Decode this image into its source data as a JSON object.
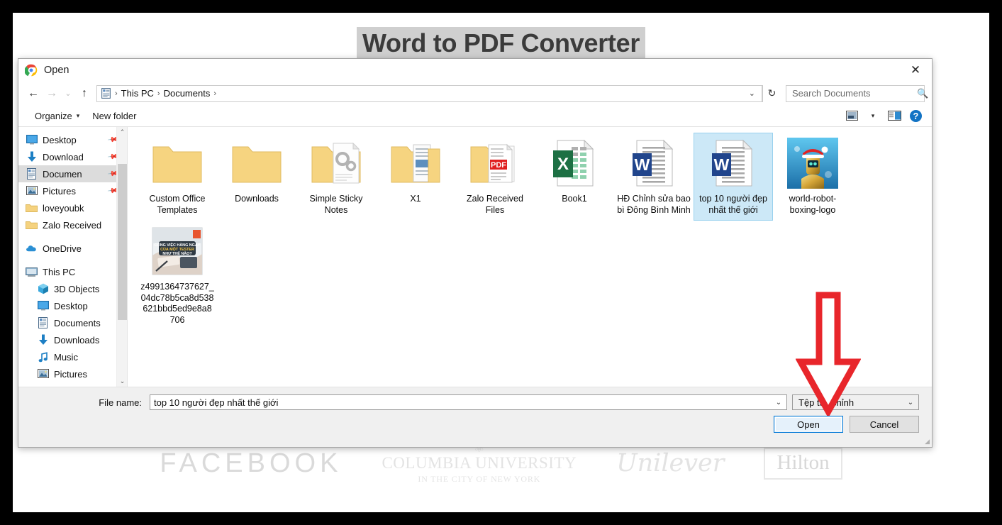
{
  "background_page": {
    "title": "Word to PDF Converter",
    "logos": [
      {
        "name": "FACEBOOK",
        "kind": "wordmark"
      },
      {
        "name": "COLUMBIA UNIVERSITY",
        "subtitle": "IN THE CITY OF NEW YORK",
        "kind": "crest"
      },
      {
        "name": "Unilever",
        "kind": "script"
      },
      {
        "name": "Hilton",
        "kind": "boxed"
      }
    ]
  },
  "dialog": {
    "title": "Open",
    "app_icon": "chrome-icon",
    "close_label": "✕",
    "navigation": {
      "back": "←",
      "forward": "→",
      "recent": "⌄",
      "up": "↑"
    },
    "breadcrumb": {
      "icon": "documents-icon",
      "segments": [
        "This PC",
        "Documents"
      ],
      "separator": "›",
      "trailing_separator": "›",
      "dropdown": "⌄",
      "refresh": "↻"
    },
    "search": {
      "placeholder": "Search Documents",
      "value": "",
      "icon": "search-icon"
    },
    "command_bar": {
      "organize": "Organize",
      "organize_caret": "▾",
      "new_folder": "New folder",
      "view_icon": "view-options-icon",
      "view_caret": "▾",
      "pane_icon": "preview-pane-icon",
      "help_icon": "help-icon",
      "help_glyph": "?"
    },
    "nav_pane": {
      "items": [
        {
          "label": "Desktop",
          "icon": "desktop-icon",
          "pinned": true,
          "indent": 0,
          "selected": false
        },
        {
          "label": "Download",
          "icon": "download-icon",
          "pinned": true,
          "indent": 0,
          "selected": false
        },
        {
          "label": "Documen",
          "icon": "documents-icon",
          "pinned": true,
          "indent": 0,
          "selected": true
        },
        {
          "label": "Pictures",
          "icon": "pictures-icon",
          "pinned": true,
          "indent": 0,
          "selected": false
        },
        {
          "label": "loveyoubk",
          "icon": "folder-icon",
          "pinned": false,
          "indent": 0,
          "selected": false
        },
        {
          "label": "Zalo Received",
          "icon": "folder-icon",
          "pinned": false,
          "indent": 0,
          "selected": false
        },
        {
          "label": "__GAP__",
          "icon": "",
          "pinned": false,
          "indent": 0,
          "selected": false
        },
        {
          "label": "OneDrive",
          "icon": "onedrive-icon",
          "pinned": false,
          "indent": 0,
          "selected": false
        },
        {
          "label": "__GAP__",
          "icon": "",
          "pinned": false,
          "indent": 0,
          "selected": false
        },
        {
          "label": "This PC",
          "icon": "thispc-icon",
          "pinned": false,
          "indent": 0,
          "selected": false
        },
        {
          "label": "3D Objects",
          "icon": "3dobjects-icon",
          "pinned": false,
          "indent": 1,
          "selected": false
        },
        {
          "label": "Desktop",
          "icon": "desktop-icon",
          "pinned": false,
          "indent": 1,
          "selected": false
        },
        {
          "label": "Documents",
          "icon": "documents-icon",
          "pinned": false,
          "indent": 1,
          "selected": false
        },
        {
          "label": "Downloads",
          "icon": "download-icon",
          "pinned": false,
          "indent": 1,
          "selected": false
        },
        {
          "label": "Music",
          "icon": "music-icon",
          "pinned": false,
          "indent": 1,
          "selected": false
        },
        {
          "label": "Pictures",
          "icon": "pictures-icon",
          "pinned": false,
          "indent": 1,
          "selected": false
        }
      ],
      "scrollbar": {
        "up": "⌃",
        "down": "⌄"
      }
    },
    "files": [
      {
        "name": "Custom Office Templates",
        "type": "folder",
        "selected": false
      },
      {
        "name": "Downloads",
        "type": "folder",
        "selected": false
      },
      {
        "name": "Simple Sticky Notes",
        "type": "folder-gear",
        "selected": false
      },
      {
        "name": "X1",
        "type": "folder-docs",
        "selected": false
      },
      {
        "name": "Zalo Received Files",
        "type": "folder-pdf",
        "selected": false
      },
      {
        "name": "Book1",
        "type": "excel",
        "selected": false
      },
      {
        "name": "HĐ Chỉnh sửa bao bì Đông Bình Minh",
        "type": "word",
        "selected": false
      },
      {
        "name": "top 10 người đẹp nhất thế giới",
        "type": "word",
        "selected": true
      },
      {
        "name": "world-robot-boxing-logo",
        "type": "image-robot",
        "selected": false
      },
      {
        "name": "z4991364737627_04dc78b5ca8d538621bbd5ed9e8a8706",
        "type": "image-photo",
        "selected": false
      }
    ],
    "footer": {
      "filename_label": "File name:",
      "filename_value": "top 10 người đẹp nhất thế giới",
      "filename_dropdown": "⌄",
      "filetype_value": "Tệp tùy chỉnh",
      "filetype_caret": "⌄",
      "open_button": "Open",
      "cancel_button": "Cancel"
    }
  },
  "annotation": {
    "arrow": {
      "color": "#e8262b",
      "direction": "down",
      "points_to": "open-button"
    }
  },
  "colors": {
    "selection_fill": "#cce8f7",
    "selection_border": "#99d1ee",
    "nav_selected": "#dcdcdc",
    "primary_button_border": "#0078d7",
    "footer_bg": "#f0f0f0",
    "annotation_red": "#e8262b",
    "title_highlight": "#cfcfcf"
  }
}
